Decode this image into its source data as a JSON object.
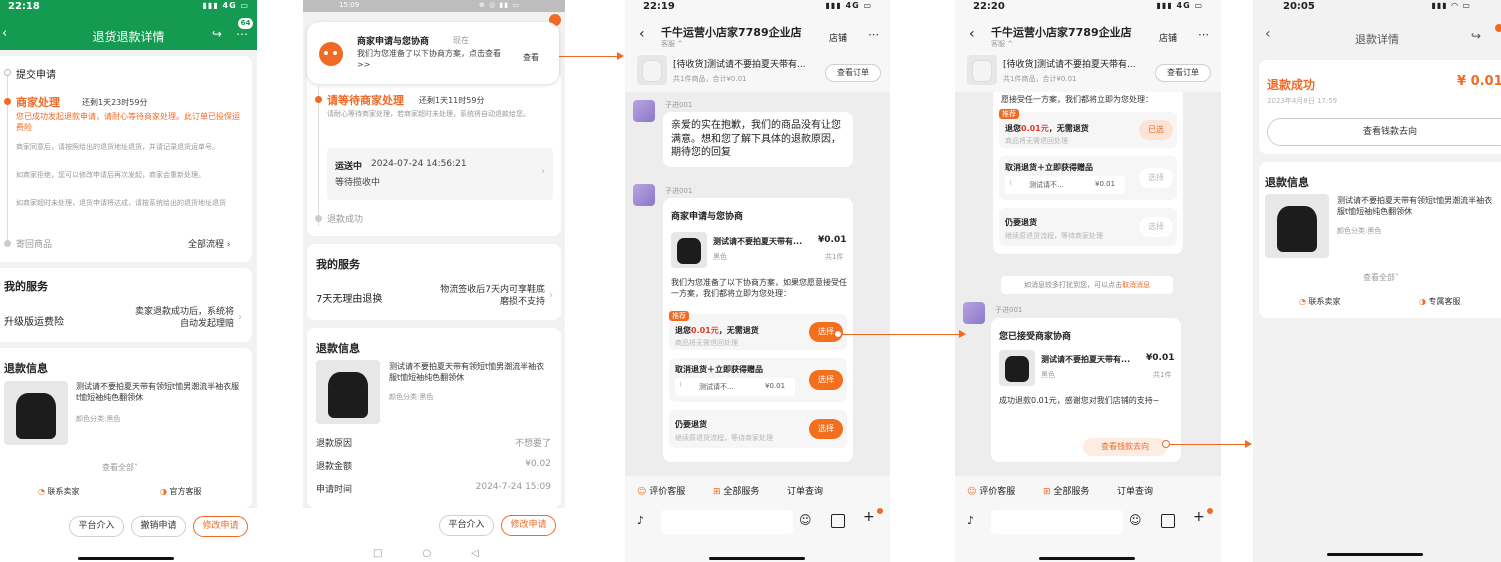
{
  "p1": {
    "time": "22:18",
    "signal": "4G",
    "badge": "64",
    "title": "退货退款详情",
    "steps": {
      "submit": "提交申请",
      "merchant_title": "商家处理",
      "merchant_countdown": "还剩1天23时59分",
      "merchant_alert": "您已成功发起退款申请，请耐心等待商家处理。此订单已投保运费险",
      "merchant_desc_1": "商家同意后，请按照给出的退货地址退货，并请记录退货运单号。",
      "merchant_desc_2": "如商家拒绝，您可以修改申请后再次发起，商家会重新处理。",
      "merchant_desc_3": "如商家超时未处理，退货申请将达成，请按系统给出的退货地址退货",
      "return": "寄回商品",
      "all_flow": "全部流程"
    },
    "service": {
      "title": "我的服务",
      "label": "升级版运费险",
      "value": "卖家退款成功后，系统将自动发起理赔"
    },
    "refund": {
      "title": "退款信息",
      "product": "测试请不要拍夏天带有领短t恤男潮流半袖衣服t恤短袖纯色翻领休",
      "spec": "颜色分类:黑色",
      "view_all": "查看全部"
    },
    "contact_seller": "联系卖家",
    "official_service": "官方客服",
    "buttons": {
      "platform": "平台介入",
      "cancel": "撤销申请",
      "modify": "修改申请"
    }
  },
  "p2": {
    "time": "15:09",
    "notification": {
      "title": "商家申请与您协商",
      "time": "现在",
      "body": "我们为您准备了以下协商方案，点击查看>>",
      "action": "查看"
    },
    "wait_title": "请等待商家处理",
    "wait_countdown": "还剩1天11时59分",
    "wait_desc": "请耐心等待商家处理，若商家超时未处理，系统将自动退款给您。",
    "shipping_status": "运送中",
    "shipping_time": "2024-07-24 14:56:21",
    "shipping_sub": "等待揽收中",
    "refund_success": "退款成功",
    "service": {
      "title": "我的服务",
      "label": "7天无理由退换",
      "value": "物流签收后7天内可享鞋底磨损不支持"
    },
    "refund": {
      "title": "退款信息",
      "product": "测试请不要拍夏天带有领短t恤男潮流半袖衣服t恤短袖纯色翻领休",
      "spec": "颜色分类:黑色",
      "rows": [
        {
          "label": "退款原因",
          "value": "不想要了"
        },
        {
          "label": "退款金额",
          "value": "¥0.02"
        },
        {
          "label": "申请时间",
          "value": "2024-7-24 15:09"
        }
      ]
    },
    "buttons": {
      "platform": "平台介入",
      "modify": "修改申请"
    }
  },
  "p3": {
    "time": "22:19",
    "signal": "4G",
    "shop_name": "千牛运营小店家7789企业店",
    "shop_sub": "客服 ^",
    "shop_btn": "店铺",
    "order_title": "[待收货]测试请不要拍夏天带有...",
    "order_sub": "共1件商品，合计¥0.01",
    "view_order": "查看订单",
    "agent_name": "子进001",
    "apology": "亲爱的实在抱歉，我们的商品没有让您满意。想和您了解下具体的退款原因，期待您的回复",
    "agent_name_2": "子进001",
    "nego_title": "商家申请与您协商",
    "product_name": "测试请不要拍夏天带有...",
    "product_price": "¥0.01",
    "product_spec": "黑色",
    "product_qty": "共1件",
    "nego_desc": "我们为您准备了以下协商方案，如果您愿意接受任一方案，我们都将立即为您处理：",
    "opt1_tag": "推荐",
    "opt1_title_a": "退您",
    "opt1_amount": "0.01元",
    "opt1_title_b": "，无需退货",
    "opt1_sub": "商品将无需退回处理",
    "opt2_title": "取消退货＋立即获得赠品",
    "opt2_item": "测试请不...",
    "opt2_price": "¥0.01",
    "opt3_title": "仍要退货",
    "opt3_sub": "继续原退货流程，等待商家处理",
    "select": "选择",
    "bottom": {
      "rate": "评价客服",
      "all": "全部服务",
      "order": "订单查询"
    }
  },
  "p4": {
    "time": "22:20",
    "signal": "4G",
    "shop_name": "千牛运营小店家7789企业店",
    "shop_sub": "客服 ^",
    "shop_btn": "店铺",
    "order_title": "[待收货]测试请不要拍夏天带有...",
    "order_sub": "共1件商品，合计¥0.01",
    "view_order": "查看订单",
    "top_cut": "愿接受任一方案，我们都将立即为您处理：",
    "opt1_tag": "推荐",
    "opt1_title_a": "退您",
    "opt1_amount": "0.01元",
    "opt1_title_b": "，无需退货",
    "opt1_sub": "商品将无需退回处理",
    "selected": "已选",
    "opt2_title": "取消退货＋立即获得赠品",
    "opt2_item": "测试请不...",
    "opt2_price": "¥0.01",
    "opt3_title": "仍要退货",
    "opt3_sub": "继续原退货流程，等待商家处理",
    "select": "选择",
    "system_a": "如消息较多打扰到您，可以点击",
    "system_b": "取消消息",
    "agent_name": "子进001",
    "accepted_title": "您已接受商家协商",
    "product_name": "测试请不要拍夏天带有...",
    "product_price": "¥0.01",
    "product_spec": "黑色",
    "product_qty": "共1件",
    "accepted_desc": "成功退款0.01元，感谢您对我们店铺的支持~",
    "view_money": "查看钱款去向",
    "bottom": {
      "rate": "评价客服",
      "all": "全部服务",
      "order": "订单查询"
    }
  },
  "p5": {
    "time": "20:05",
    "title": "退款详情",
    "status": "退款成功",
    "amount": "¥ 0.01",
    "date": "2023年4月8日 17:59",
    "view_money": "查看钱款去向",
    "refund_title": "退款信息",
    "product": "测试请不要拍夏天带有领短t恤男潮流半袖衣服t恤短袖纯色翻领休",
    "spec": "颜色分类:黑色",
    "view_all": "查看全部",
    "contact_seller": "联系卖家",
    "exclusive_service": "专属客服"
  },
  "colors": {
    "accent": "#f06a26",
    "header_green": "#159a52",
    "red": "#e23a2a"
  }
}
